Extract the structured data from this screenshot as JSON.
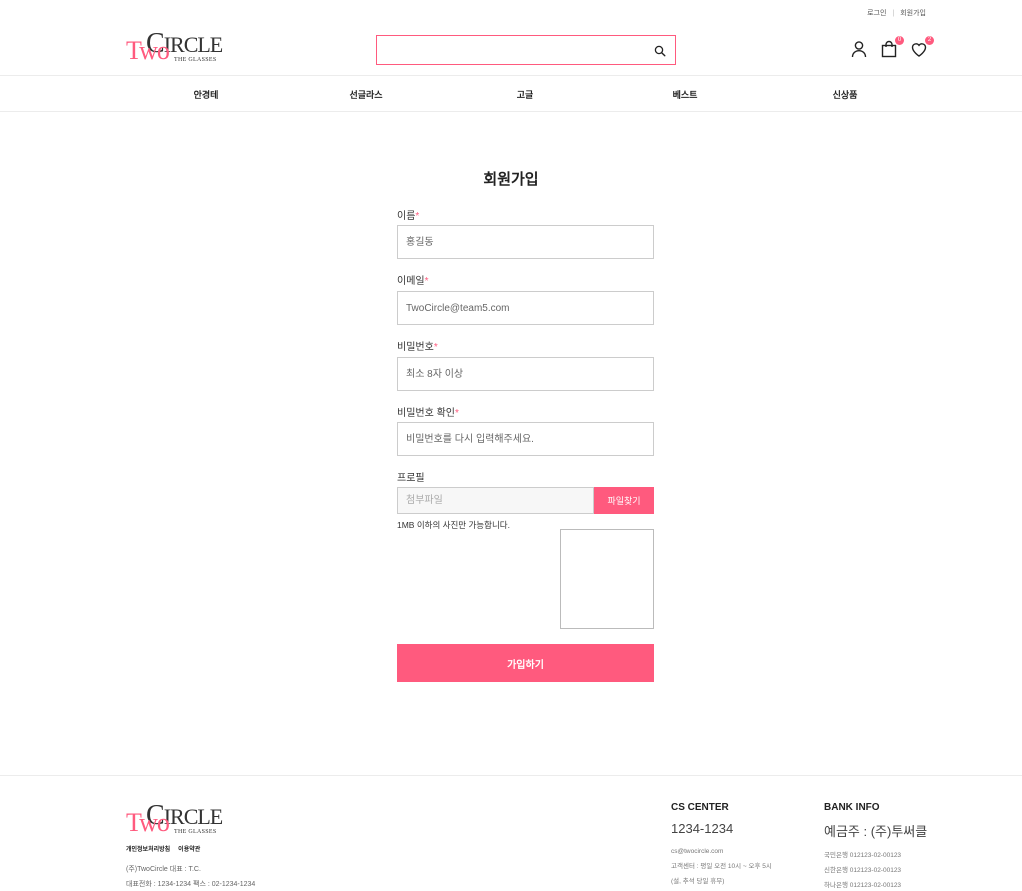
{
  "util": {
    "login": "로그인",
    "signup": "회원가입",
    "sep": "|"
  },
  "logo": {
    "two": "Two",
    "circle_c": "C",
    "circle_rest": "IRCLE",
    "glasses": "THE GLASSES"
  },
  "search": {
    "value": "",
    "placeholder": ""
  },
  "header_icons": {
    "cart_count": "0",
    "wish_count": "2"
  },
  "nav": [
    "안경테",
    "선글라스",
    "고글",
    "베스트",
    "신상품"
  ],
  "form": {
    "title": "회원가입",
    "required_mark": "*",
    "name_label": "이름",
    "name_placeholder": "홍길동",
    "email_label": "이메일",
    "email_placeholder": "TwoCircle@team5.com",
    "password_label": "비밀번호",
    "password_placeholder": "최소 8자 이상",
    "password_confirm_label": "비밀번호 확인",
    "password_confirm_placeholder": "비밀번호를 다시 입력해주세요.",
    "profile_label": "프로필",
    "file_placeholder": "첨부파일",
    "file_button": "파일찾기",
    "file_hint": "1MB 이하의 사진만 가능합니다.",
    "submit": "가입하기"
  },
  "footer": {
    "links": [
      "개인정보처리방침",
      "이용약관"
    ],
    "company": "(주)TwoCircle    대표 : T.C.",
    "contact": "대표전화 : 1234-1234    팩스 : 02-1234-1234",
    "cs": {
      "title": "CS CENTER",
      "phone": "1234-1234",
      "lines": [
        "cs@twocircle.com",
        "고객센터 : 평일 오전 10시 ~ 오후 5시",
        "(설, 추석 당일 휴무)"
      ]
    },
    "bank": {
      "title": "BANK INFO",
      "holder": "예금주 : (주)투써클",
      "lines": [
        "국민은행 012123-02-00123",
        "신한은행 012123-02-00123",
        "하나은행 012123-02-00123"
      ]
    }
  },
  "colors": {
    "accent": "#ff5a7e",
    "border": "#cccccc",
    "text": "#222222"
  }
}
